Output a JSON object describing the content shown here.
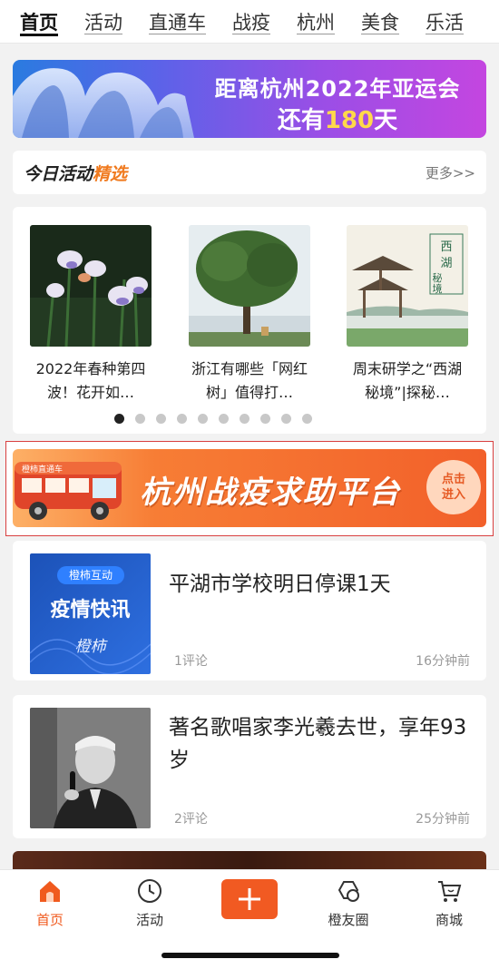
{
  "top_tabs": [
    {
      "label": "首页",
      "active": true
    },
    {
      "label": "活动"
    },
    {
      "label": "直通车"
    },
    {
      "label": "战疫"
    },
    {
      "label": "杭州"
    },
    {
      "label": "美食"
    },
    {
      "label": "乐活"
    }
  ],
  "asia_banner": {
    "line1": "距离杭州2022年亚运会",
    "prefix": "还有",
    "days": "180",
    "suffix": "天"
  },
  "activities": {
    "title_main": "今日活动",
    "title_highlight": "精选",
    "more": "更多>>",
    "items": [
      {
        "caption": "2022年春种第四波！花开如…"
      },
      {
        "caption": "浙江有哪些「网红树」值得打…"
      },
      {
        "caption": "周末研学之“西湖秘境”|探秘…"
      }
    ],
    "dot_count": 10,
    "active_dot": 0
  },
  "help_banner": {
    "bus_text": "橙柿直通车",
    "title": "杭州战疫求助平台",
    "enter_line1": "点击",
    "enter_line2": "进入"
  },
  "news": [
    {
      "title": "平湖市学校明日停课1天",
      "comments": "1评论",
      "time": "16分钟前",
      "thumb_brand": "橙柿互动",
      "thumb_title": "疫情快讯",
      "thumb_logo": "橙柿"
    },
    {
      "title": "著名歌唱家李光羲去世，享年93岁",
      "comments": "2评论",
      "time": "25分钟前"
    }
  ],
  "bottom_nav": [
    {
      "label": "首页",
      "icon": "home-icon",
      "active": true
    },
    {
      "label": "活动",
      "icon": "clock-icon"
    },
    {
      "label": "",
      "icon": "plus-icon"
    },
    {
      "label": "橙友圈",
      "icon": "circle-icon"
    },
    {
      "label": "商城",
      "icon": "cart-icon"
    }
  ],
  "colors": {
    "accent": "#f05a1e",
    "highlight": "#f07a1e"
  }
}
